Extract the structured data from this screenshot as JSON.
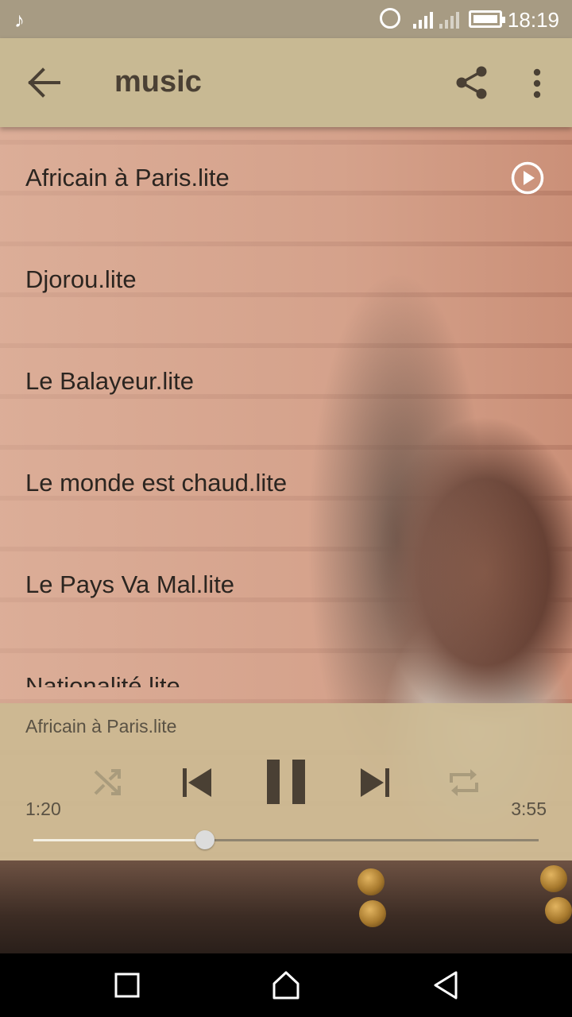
{
  "status_bar": {
    "time": "18:19",
    "music_note_icon": "music-note-icon",
    "alarm_icon": "alarm-icon",
    "signal_icons": [
      "signal-icon",
      "signal-icon-dim"
    ],
    "battery_icon": "battery-icon"
  },
  "app_bar": {
    "title": "music",
    "back_icon": "arrow-back-icon",
    "share_icon": "share-icon",
    "more_icon": "more-vert-icon",
    "background": "#c8b993"
  },
  "songs": [
    {
      "title": "Africain à Paris.lite",
      "playing": true
    },
    {
      "title": "Djorou.lite"
    },
    {
      "title": "Le Balayeur.lite"
    },
    {
      "title": "Le monde est chaud.lite"
    },
    {
      "title": "Le Pays Va Mal.lite"
    },
    {
      "title": "Nationalité.lite"
    }
  ],
  "player": {
    "now_playing": "Africain à Paris.lite",
    "current_time": "1:20",
    "total_time": "3:55",
    "progress": 0.34,
    "controls": [
      "shuffle-icon",
      "skip-previous-icon",
      "pause-icon",
      "skip-next-icon",
      "repeat-icon"
    ],
    "background": "#cdbb94"
  },
  "nav_bar": {
    "icons": [
      "recents-square-icon",
      "home-icon",
      "back-triangle-icon"
    ]
  }
}
